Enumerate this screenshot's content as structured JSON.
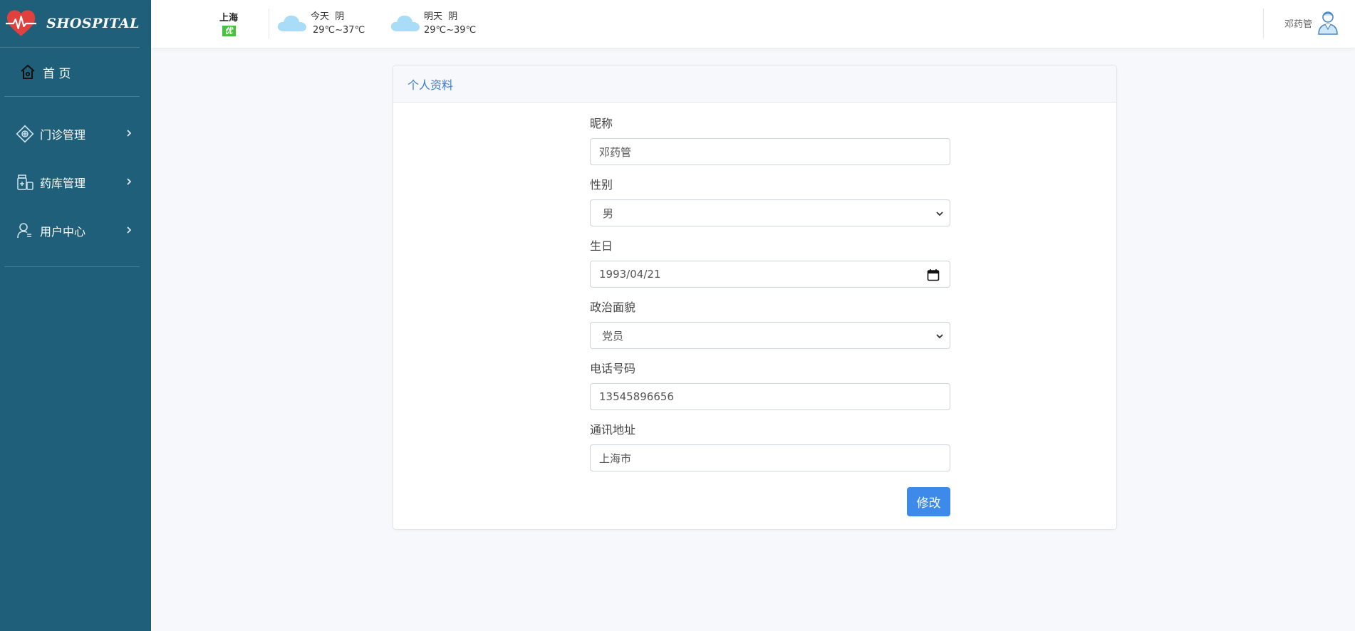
{
  "brand": {
    "name": "SHOSPITAL"
  },
  "sidebar": {
    "home_label": "首 页",
    "items": [
      {
        "label": "门诊管理"
      },
      {
        "label": "药库管理"
      },
      {
        "label": "用户中心"
      }
    ]
  },
  "header": {
    "city": "上海",
    "aqi": "优",
    "today": {
      "label": "今天",
      "condition": "阴",
      "range": "29℃~37℃"
    },
    "tomorrow": {
      "label": "明天",
      "condition": "阴",
      "range": "29℃~39℃"
    },
    "user_name": "邓药管"
  },
  "card": {
    "title": "个人资料",
    "fields": {
      "nickname": {
        "label": "昵称",
        "value": "邓药管"
      },
      "gender": {
        "label": "性别",
        "value": "男"
      },
      "birthday": {
        "label": "生日",
        "value": "1993/04/21"
      },
      "political": {
        "label": "政治面貌",
        "value": "党员"
      },
      "phone": {
        "label": "电话号码",
        "value": "13545896656"
      },
      "address": {
        "label": "通讯地址",
        "value": "上海市"
      }
    },
    "submit_label": "修改"
  },
  "colors": {
    "sidebar_bg": "#1f5f7a",
    "accent": "#3d8aeb",
    "aqi_badge": "#48c23d",
    "title_blue": "#3a7bd5"
  }
}
